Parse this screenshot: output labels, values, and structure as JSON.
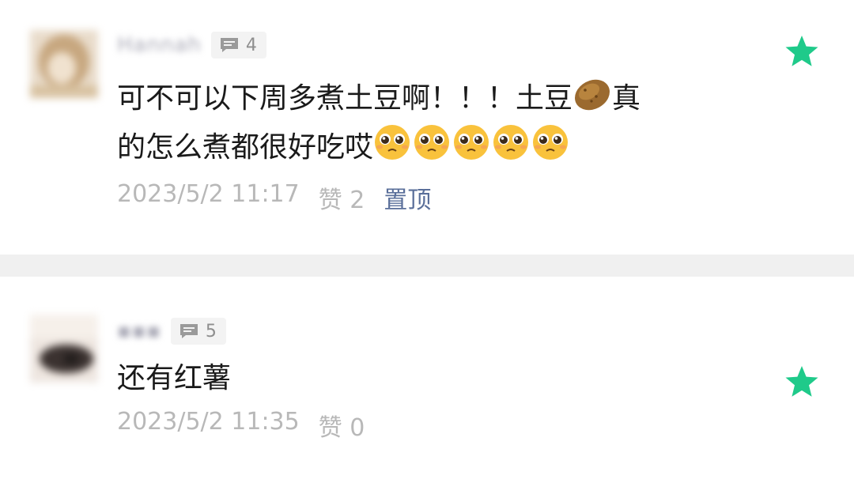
{
  "comments": [
    {
      "name": "Hannah",
      "reply_count": "4",
      "text_line1": "可不可以下周多煮土豆啊！！！土豆",
      "text_line1_end": "真",
      "text_line2": "的怎么煮都很好吃哎",
      "inline_icons": [
        "potato-emoji",
        "pleading-face-emoji"
      ],
      "date": "2023/5/2 11:17",
      "likes": "赞 2",
      "pin_label": "置顶"
    },
    {
      "name": "▪▪▪",
      "reply_count": "5",
      "text": "还有红薯",
      "date": "2023/5/2 11:35",
      "likes": "赞 0"
    }
  ],
  "colors": {
    "star": "#1fca8a",
    "pin_link": "#5a6f9a",
    "meta_gray": "#b8b8b8",
    "divider": "#f0f0f0"
  },
  "icons": {
    "reply": "comment-bubble-icon",
    "featured": "star-icon"
  }
}
